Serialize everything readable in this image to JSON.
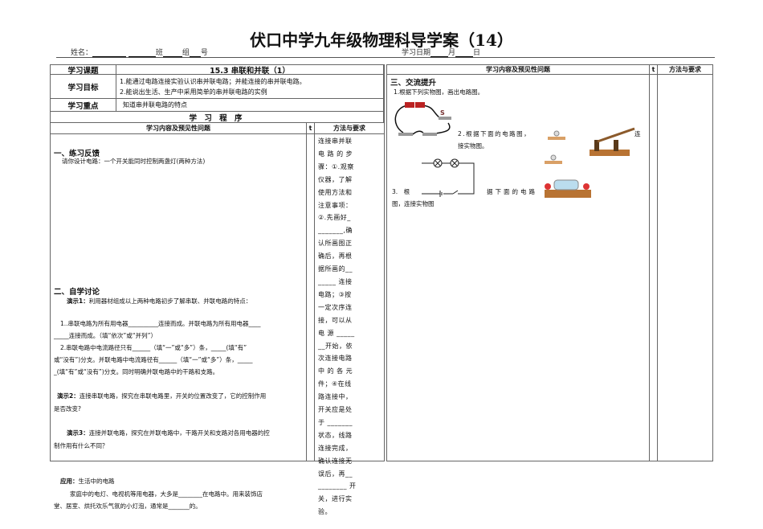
{
  "header": {
    "title": "伏口中学九年级物理科导学案（14）",
    "name_label": "姓名：",
    "class_label": "班",
    "group_label": "组",
    "number_label": "号",
    "date_label": "学习日期",
    "month_label": "月",
    "day_label": "日"
  },
  "info_table": {
    "topic_label": "学习课题",
    "topic": "15.3 串联和并联（1）",
    "goal_label": "学习目标",
    "goals": [
      "1.能通过电路连接实验认识串并联电路；并能连接的串并联电路。",
      "2.能说出生活、生产中采用简单的串并联电路的实例"
    ],
    "focus_label": "学习重点",
    "focus": "知道串并联电路的特点",
    "procedure_label": "学 习 程 序"
  },
  "columns": {
    "content": "学习内容及预见性问题",
    "t": "t",
    "method": "方法与要求"
  },
  "left": {
    "s1_title": "一、练习反馈",
    "s1_text": "请你设计电路：一个开关能同时控制两盏灯(两种方法)",
    "s2_title": "二、自学讨论",
    "demo1_label": "演示1：",
    "demo1_text": "利用器材组成以上两种电路初步了解串联、并联电路的特点：",
    "q1a": "1..串联电路为所有用电器__________连接而成。并联电路为所有用电器____",
    "q1b": "_____连接而成。（填“依次”或“并列”）",
    "q2a": "2.串联电路中电流路径只有______（填“一”或“多”）条，_____(填“有”",
    "q2b": "或“没有”)分支。并联电路中电流路径有______（填“一”或“多”）条，_____",
    "q2c": "_(填“有”或“没有”)分支。同时明确并联电路中的干路和支路。",
    "demo2_label": "演示2：",
    "demo2_text": "连接串联电路，探究在串联电路里，开关的位置改变了，它的控制作用",
    "demo2_text2": "是否改变?",
    "demo3_label": "演示3：",
    "demo3_text": "连接并联电路，探究在并联电路中，干路开关和支路对各用电器的控",
    "demo3_text2": "制作用有什么不同？",
    "app_label": "应用：",
    "app_title": "生活中的电路",
    "app1": "家庭中的电灯、电视机等用电器，大多是________在电路中。用来装饰店",
    "app2": "堂、居室、烘托欢乐气氛的小灯泡，通常是_______的。",
    "method_lines": [
      "连接串并联",
      "电 路 的 步",
      "骤：①.观察",
      "仪器，了解",
      "使用方法和",
      "注意事项：",
      "②.先画好_",
      "_______,确",
      "认所画图正",
      "确后，再根",
      "据所画的__",
      "_____ 连接",
      "电路；③按",
      "一定次序连",
      "接，可以从",
      "电 源 _____",
      "__开始，依",
      "次连接电路",
      "中 的 各 元",
      "件；④在线",
      "路连接中，",
      "开关应是处",
      "于 _______",
      "状态，线路",
      "连接完成，",
      "确认连接无",
      "误后，再__",
      "________ 开",
      "关，进行实",
      "验。"
    ]
  },
  "right": {
    "s3_title": "三、交流提升",
    "q1": "1.根据下列实物图，画出电路图。",
    "switch_label": "S",
    "q2a": "2.根据下面的电路图，",
    "q2b": "连",
    "q2c": "接实物图。",
    "q3a": "3.　根",
    "q3b": "据下面的电路",
    "q3c": "图，连接实物图"
  }
}
